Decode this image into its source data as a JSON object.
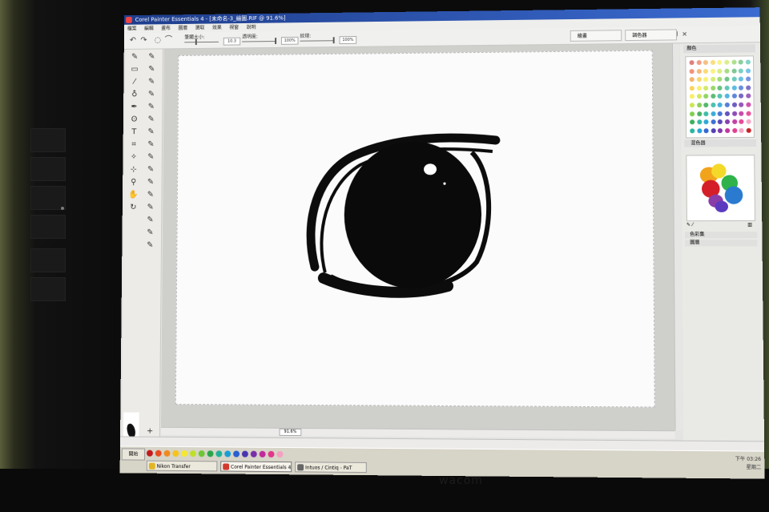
{
  "window": {
    "title": "Corel Painter Essentials 4 - [未命名-3_繪圖.RIF @ 91.6%]"
  },
  "menubar": {
    "items": [
      "檔案",
      "編輯",
      "畫布",
      "圖層",
      "選取",
      "效果",
      "視窗",
      "說明"
    ]
  },
  "property_bar": {
    "size_label": "筆觸大小:",
    "size_value": "10.3",
    "opacity_label": "透明度:",
    "opacity_value": "100%",
    "grain_label": "紋理:",
    "grain_value": "100%",
    "opacity_level": 1.0,
    "grain_level": 1.0
  },
  "panel_tabs": [
    "繪畫",
    "調色器"
  ],
  "toolbox": {
    "tools": [
      "brush-icon",
      "eraser-icon",
      "dropper-icon",
      "paint-bucket-icon",
      "pen-icon",
      "lasso-icon",
      "text-icon",
      "crop-icon",
      "magic-wand-icon",
      "transform-icon",
      "magnifier-icon",
      "hand-icon",
      "rotate-icon"
    ],
    "variant_count": 16
  },
  "status": {
    "zoom": "91.6%"
  },
  "right_panel": {
    "colors_header": "顏色",
    "mixer_header": "混色器",
    "collapsed_1": "色彩集",
    "collapsed_2": "圖層",
    "colors": "#c2181c,#e84b20,#f08a1e,#f6c31a,#f5e930,#bfe02b,#6cc730,#2aa54a,#1fb19a,#1a9ed6,#2a5fcf,#4836b0,#7a2ea8,#c02a9a,#e3368a,#f4a0c0"
  },
  "taskbar": {
    "start": "開始",
    "buttons": [
      "Nikon Transfer",
      "Corel Painter Essentials 4",
      "Intuos / Cintiq - PaT"
    ],
    "tray_line1": "下午 03:26",
    "tray_line2": "星期二"
  },
  "monitor": {
    "brand": "wacom"
  }
}
